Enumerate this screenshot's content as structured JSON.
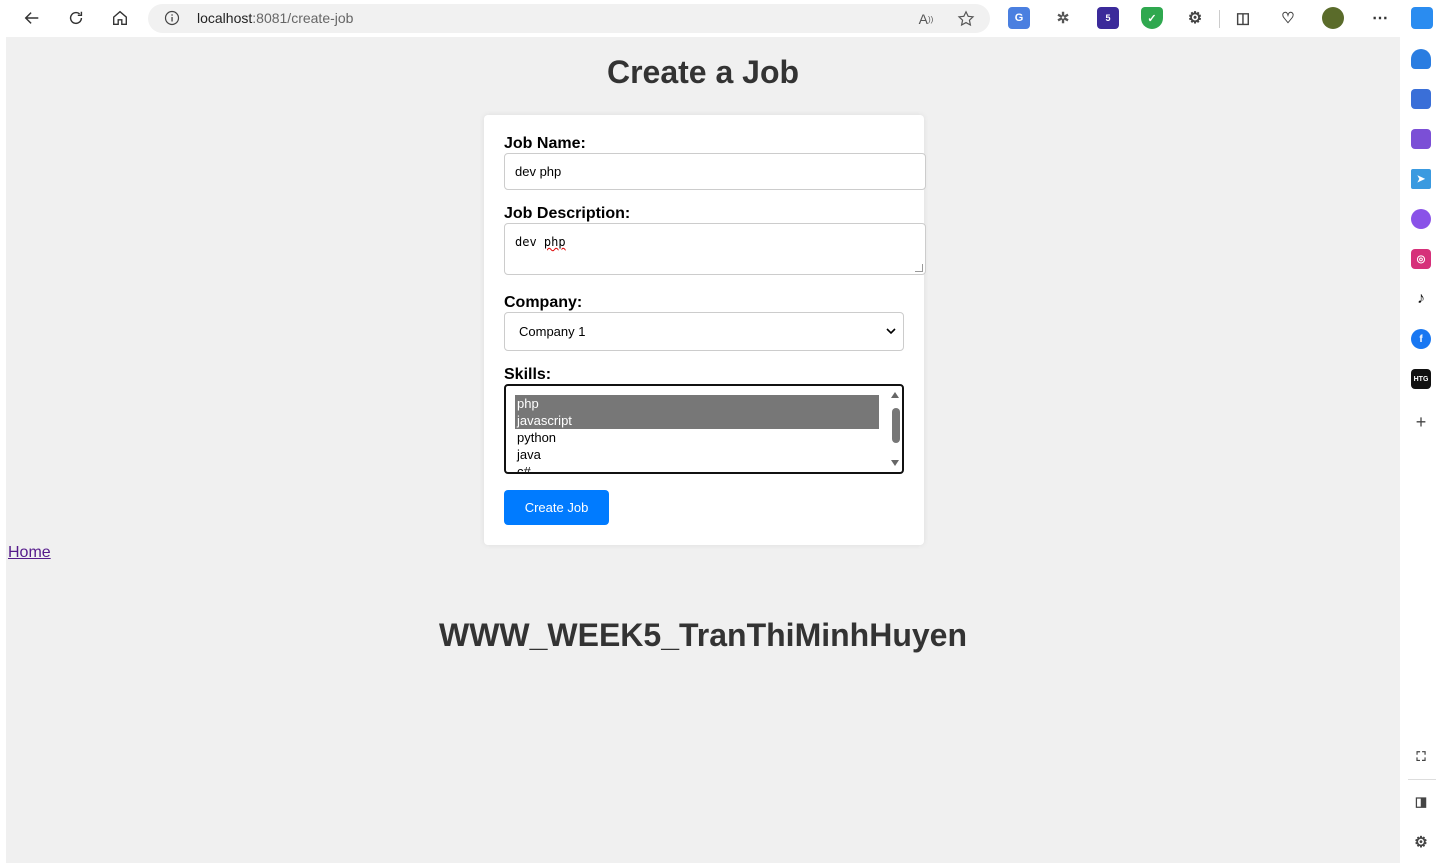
{
  "browser": {
    "url_host": "localhost",
    "url_rest": ":8081/create-job",
    "icons": [
      "back-icon",
      "refresh-icon",
      "home-icon",
      "info-icon",
      "read-aloud-icon",
      "favorite-icon",
      "translate-extension-icon",
      "bug-extension-icon",
      "stack-extension-icon",
      "shield-extension-icon",
      "extensions-icon",
      "split-screen-icon",
      "performance-icon",
      "profile-avatar",
      "more-icon",
      "copilot-icon"
    ],
    "stack_badge": "5"
  },
  "page": {
    "title": "Create a Job",
    "form": {
      "job_name_label": "Job Name:",
      "job_name_value": "dev php",
      "job_description_label": "Job Description:",
      "job_description_value_1": "dev",
      "job_description_value_2": "php",
      "company_label": "Company:",
      "company_selected": "Company 1",
      "skills_label": "Skills:",
      "skills_options": [
        {
          "label": "php",
          "selected": true
        },
        {
          "label": "javascript",
          "selected": true
        },
        {
          "label": "python",
          "selected": false
        },
        {
          "label": "java",
          "selected": false
        },
        {
          "label": "c#",
          "selected": false
        }
      ],
      "submit_label": "Create Job"
    },
    "home_link": "Home",
    "footer_title": "WWW_WEEK5_TranThiMinhHuyen"
  },
  "sidebar": {
    "items": [
      "notifications-icon",
      "shopping-tag-icon",
      "tools-icon",
      "telegram-icon",
      "messenger-icon",
      "instagram-icon",
      "tiktok-icon",
      "facebook-icon",
      "htg-icon",
      "add-icon",
      "screenshot-icon",
      "sidebar-toggle-icon",
      "settings-icon"
    ],
    "htg_label": "HTG"
  },
  "colors": {
    "accent": "#007bff",
    "page_bg": "#f0f0f0",
    "selected_option": "#777777"
  }
}
